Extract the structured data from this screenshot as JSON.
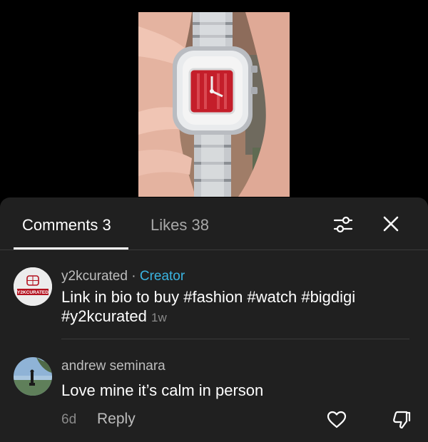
{
  "tabs": {
    "comments_label": "Comments 3",
    "likes_label": "Likes 38",
    "active": "comments"
  },
  "icons": {
    "filter": "sliders-icon",
    "close": "close-icon",
    "like": "heart-icon",
    "dislike": "thumbs-down-icon"
  },
  "comments": [
    {
      "username": "y2kcurated",
      "separator": "·",
      "badge": "Creator",
      "text": "Link in bio to buy #fashion #watch #bigdigi #y2kcurated",
      "time": "1w",
      "avatar_text": "Y2KCURATED"
    },
    {
      "username": "andrew seminara",
      "text": "Love mine it’s calm in person",
      "time": "6d",
      "reply_label": "Reply"
    }
  ],
  "colors": {
    "sheet_bg": "#202020",
    "creator_accent": "#3ab3e0",
    "watch_dial": "#c41e2a"
  }
}
